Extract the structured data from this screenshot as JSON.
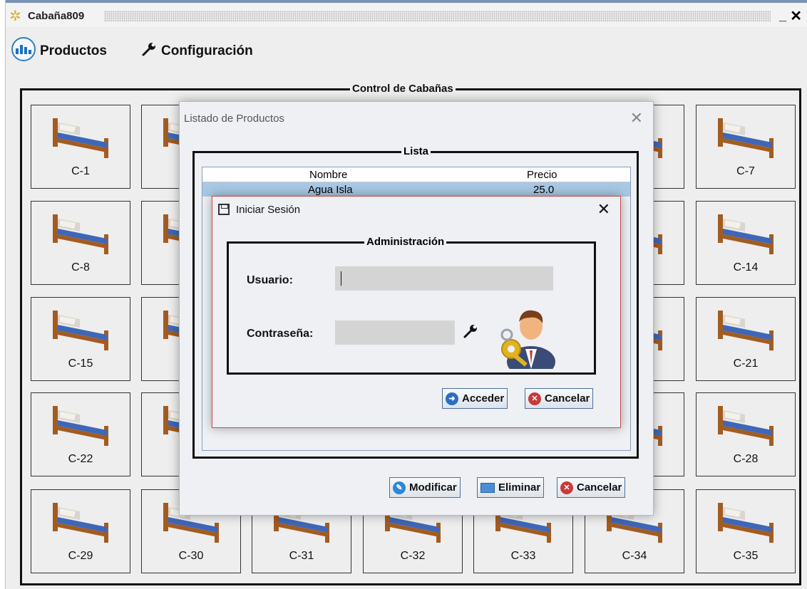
{
  "window": {
    "title": "Cabaña809",
    "minimize": "▁",
    "close": "✕"
  },
  "menu": {
    "products": "Productos",
    "config": "Configuración"
  },
  "panel": {
    "title": "Control de Cabañas"
  },
  "cabins": [
    "C-1",
    "C-7",
    "C-8",
    "C-14",
    "C-15",
    "C-21",
    "C-22",
    "C-28",
    "C-29",
    "C-30",
    "C-31",
    "C-32",
    "C-33",
    "C-34",
    "C-35"
  ],
  "productos_dialog": {
    "title": "Listado de Productos",
    "group_title": "Lista",
    "columns": [
      "Nombre",
      "Precio"
    ],
    "rows": [
      {
        "nombre": "Agua Isla",
        "precio": "25.0"
      }
    ],
    "buttons": {
      "modificar": "Modificar",
      "eliminar": "Eliminar",
      "cancelar": "Cancelar"
    }
  },
  "login_dialog": {
    "title": "Iniciar Sesión",
    "group_title": "Administración",
    "usuario_label": "Usuario:",
    "password_label": "Contraseña:",
    "usuario_value": "",
    "password_value": "",
    "buttons": {
      "acceder": "Acceder",
      "cancelar": "Cancelar"
    }
  },
  "colors": {
    "accent": "#2f7fc8",
    "selection": "#a9c8e4",
    "danger": "#c44b4b"
  }
}
